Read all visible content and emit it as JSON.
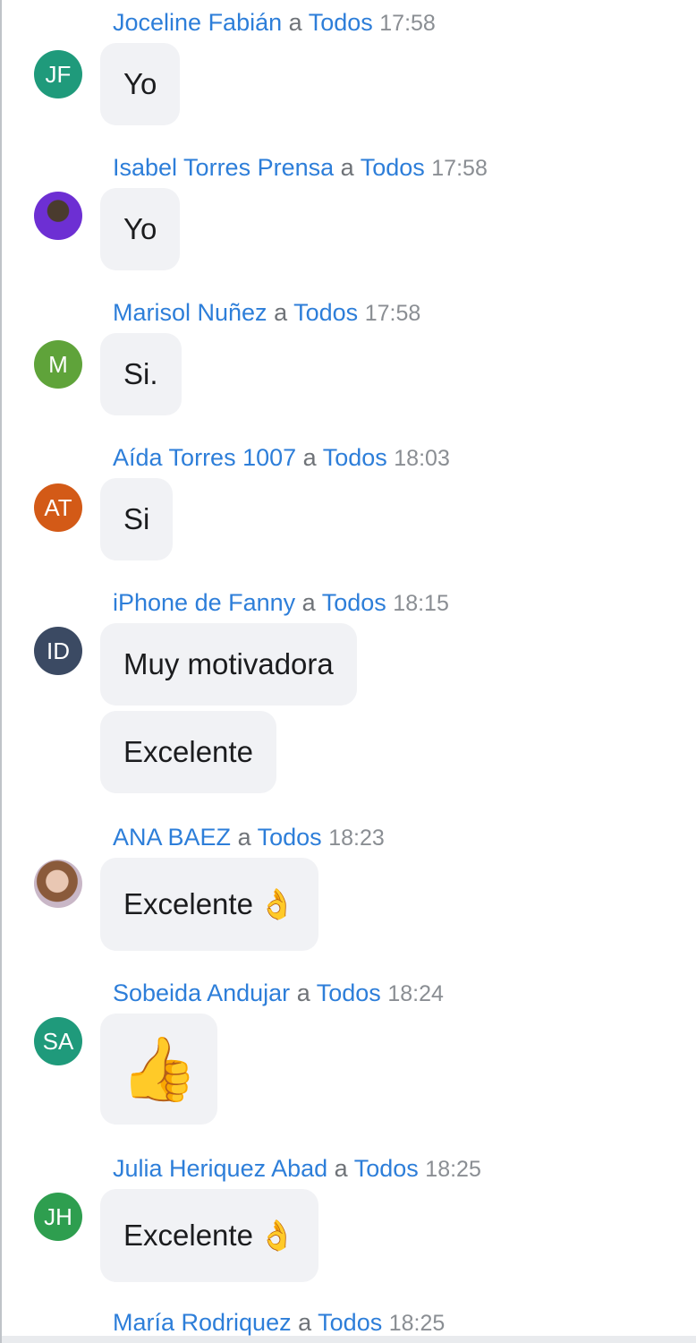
{
  "messages": [
    {
      "sender": "Joceline Fabián",
      "connector": "a",
      "recipient": "Todos",
      "time": "17:58",
      "avatar": {
        "initials": "JF",
        "color": "#1f9a7b"
      },
      "bubbles": [
        {
          "text": "Yo"
        }
      ]
    },
    {
      "sender": "Isabel Torres Prensa",
      "connector": "a",
      "recipient": "Todos",
      "time": "17:58",
      "avatar": {
        "initials": "",
        "color": "#6d2fd3",
        "type": "photo"
      },
      "bubbles": [
        {
          "text": "Yo"
        }
      ]
    },
    {
      "sender": "Marisol Nuñez",
      "connector": "a",
      "recipient": "Todos",
      "time": "17:58",
      "avatar": {
        "initials": "M",
        "color": "#5fa33a"
      },
      "bubbles": [
        {
          "text": "Si."
        }
      ]
    },
    {
      "sender": "Aída Torres 1007",
      "connector": "a",
      "recipient": "Todos",
      "time": "18:03",
      "avatar": {
        "initials": "AT",
        "color": "#d35a17"
      },
      "bubbles": [
        {
          "text": "Si"
        }
      ]
    },
    {
      "sender": "iPhone de Fanny",
      "connector": "a",
      "recipient": "Todos",
      "time": "18:15",
      "avatar": {
        "initials": "ID",
        "color": "#3b4a63"
      },
      "bubbles": [
        {
          "text": "Muy motivadora"
        },
        {
          "text": "Excelente"
        }
      ]
    },
    {
      "sender": "ANA BAEZ",
      "connector": "a",
      "recipient": "Todos",
      "time": "18:23",
      "avatar": {
        "initials": "",
        "color": "#c9b7c7",
        "type": "photo"
      },
      "bubbles": [
        {
          "text": "Excelente",
          "emoji": "ok-hand-emoji",
          "glyph": "👌"
        }
      ]
    },
    {
      "sender": "Sobeida Andujar",
      "connector": "a",
      "recipient": "Todos",
      "time": "18:24",
      "avatar": {
        "initials": "SA",
        "color": "#1f9a7b"
      },
      "bubbles": [
        {
          "text": "",
          "emoji": "thumbs-up-emoji",
          "glyph": "👍"
        }
      ]
    },
    {
      "sender": "Julia  Heriquez Abad",
      "connector": "a",
      "recipient": "Todos",
      "time": "18:25",
      "avatar": {
        "initials": "JH",
        "color": "#2e9e4f"
      },
      "bubbles": [
        {
          "text": "Excelente",
          "emoji": "ok-hand-emoji",
          "glyph": "👌"
        }
      ]
    },
    {
      "sender": "María Rodriquez",
      "connector": "a",
      "recipient": "Todos",
      "time": "18:25",
      "bubbles": []
    }
  ],
  "colors": {
    "link": "#2d7ed9",
    "bubble": "#f1f2f5",
    "timestamp": "#8a8e93"
  }
}
